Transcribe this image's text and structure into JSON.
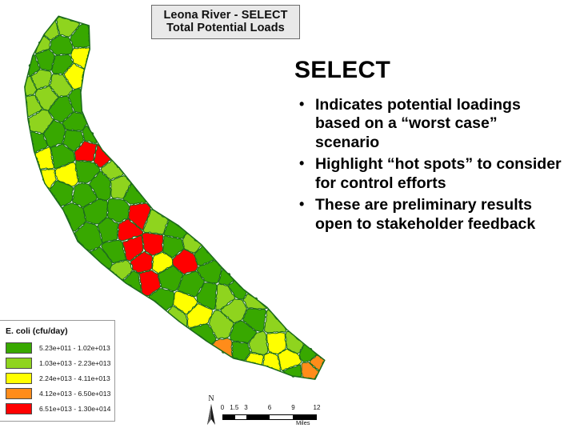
{
  "map": {
    "title_lines": [
      "Leona River - SELECT",
      "Total Potential Loads"
    ],
    "legend": {
      "title": "E. coli (cfu/day)",
      "classes": [
        {
          "color": "#38a800",
          "label": "5.23e+011 - 1.02e+013"
        },
        {
          "color": "#8fd41e",
          "label": "1.03e+013 - 2.23e+013"
        },
        {
          "color": "#ffff00",
          "label": "2.24e+013 - 4.11e+013"
        },
        {
          "color": "#ff8c1a",
          "label": "4.12e+013 - 6.50e+013"
        },
        {
          "color": "#ff0000",
          "label": "6.51e+013 - 1.30e+014"
        }
      ]
    },
    "north_arrow_label": "N",
    "scalebar": {
      "ticks": [
        "0",
        "1.5",
        "3",
        "6",
        "9",
        "12"
      ],
      "units": "Miles"
    },
    "outline_color": "#1c6b1c"
  },
  "text_panel": {
    "heading": "SELECT",
    "bullets": [
      "Indicates potential loadings based on a “worst case” scenario",
      "Highlight “hot spots” to consider for control efforts",
      "These are preliminary results open to stakeholder feedback"
    ]
  },
  "chart_data": {
    "type": "map",
    "title": "Leona River - SELECT Total Potential Loads",
    "legend_title": "E. coli (cfu/day)",
    "unit": "cfu/day",
    "classification": "graduated-color choropleth, 5 classes",
    "classes": [
      {
        "rank": 1,
        "color": "#38a800",
        "name": "dark-green",
        "min": 523000000000.0,
        "max": 10200000000000.0,
        "label": "5.23e+011 - 1.02e+013"
      },
      {
        "rank": 2,
        "color": "#8fd41e",
        "name": "light-green",
        "min": 10300000000000.0,
        "max": 22300000000000.0,
        "label": "1.03e+013 - 2.23e+013"
      },
      {
        "rank": 3,
        "color": "#ffff00",
        "name": "yellow",
        "min": 22400000000000.0,
        "max": 41100000000000.0,
        "label": "2.24e+013 - 4.11e+013"
      },
      {
        "rank": 4,
        "color": "#ff8c1a",
        "name": "orange",
        "min": 41200000000000.0,
        "max": 65000000000000.0,
        "label": "4.12e+013 - 6.50e+013"
      },
      {
        "rank": 5,
        "color": "#ff0000",
        "name": "red",
        "min": 65100000000000.0,
        "max": 130000000000000.0,
        "label": "6.51e+013 - 1.30e+014"
      }
    ],
    "scale_ticks_miles": [
      0,
      1.5,
      3,
      6,
      9,
      12
    ],
    "orientation": "north-up",
    "watershed": "Leona River",
    "subwatershed_class_counts": {
      "dark-green": 58,
      "light-green": 44,
      "yellow": 12,
      "orange": 3,
      "red": 7
    }
  }
}
